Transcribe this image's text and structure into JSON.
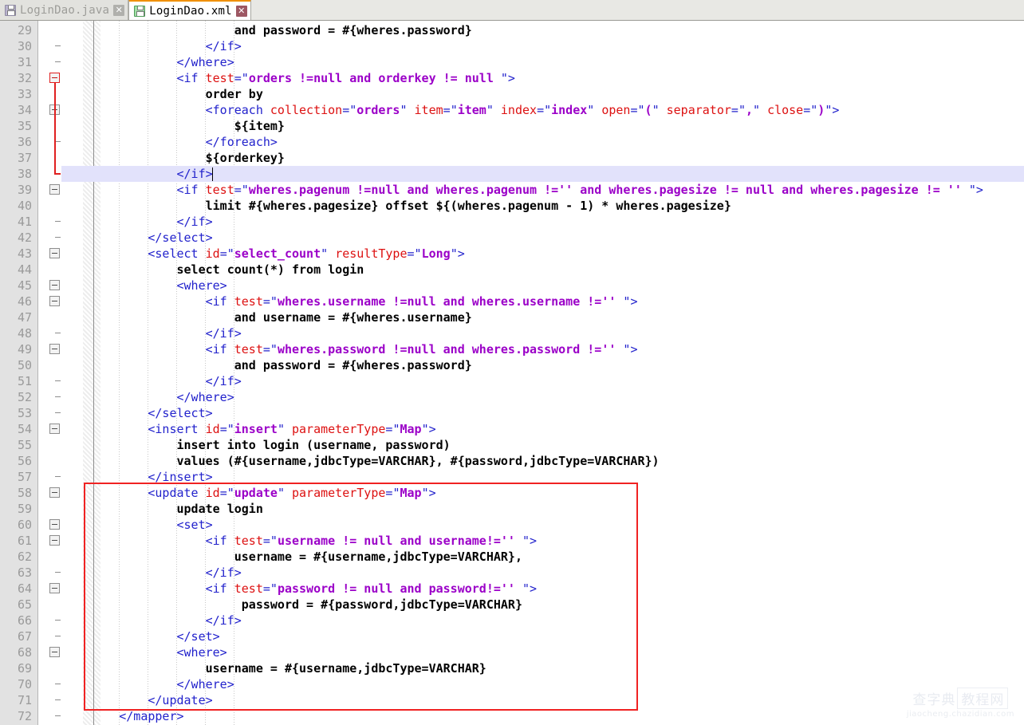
{
  "tabs": [
    {
      "label": "LoginDao.java",
      "icon": "file-java-icon",
      "close_label": "✕",
      "active": false
    },
    {
      "label": "LoginDao.xml",
      "icon": "file-xml-icon",
      "close_label": "✕",
      "active": true
    }
  ],
  "editor": {
    "active_file": "LoginDao.xml",
    "current_line": 38,
    "first_visible_line": 29,
    "last_visible_line": 72,
    "colors": {
      "tag": "#2222cc",
      "attribute_name": "#dd1111",
      "attribute_value": "#9b00c8",
      "text": "#000000",
      "gutter_background": "#e2e2e2",
      "line_number": "#9a9a9a",
      "current_line_highlight": "#e2e2fb",
      "annotation_box": "#f02222",
      "active_tab_accent": "#f09000"
    },
    "lines": [
      {
        "n": 29,
        "fold": "none",
        "tokens": [
          {
            "c": "txt",
            "s": "                        and password = #{wheres.password}"
          }
        ]
      },
      {
        "n": 30,
        "fold": "tick",
        "tokens": [
          {
            "c": "t",
            "s": "                    </if>"
          }
        ]
      },
      {
        "n": 31,
        "fold": "tick",
        "tokens": [
          {
            "c": "t",
            "s": "                </where>"
          }
        ]
      },
      {
        "n": 32,
        "fold": "box-red",
        "tokens": [
          {
            "c": "t",
            "s": "                <if "
          },
          {
            "c": "a",
            "s": "test"
          },
          {
            "c": "t",
            "s": "="
          },
          {
            "c": "q",
            "s": "\""
          },
          {
            "c": "v",
            "s": "orders !=null and orderkey != null "
          },
          {
            "c": "q",
            "s": "\""
          },
          {
            "c": "t",
            "s": ">"
          }
        ]
      },
      {
        "n": 33,
        "fold": "runred",
        "tokens": [
          {
            "c": "txt",
            "s": "                    order by"
          }
        ]
      },
      {
        "n": 34,
        "fold": "box-grey-red",
        "tokens": [
          {
            "c": "t",
            "s": "                    <foreach "
          },
          {
            "c": "a",
            "s": "collection"
          },
          {
            "c": "t",
            "s": "="
          },
          {
            "c": "q",
            "s": "\""
          },
          {
            "c": "v",
            "s": "orders"
          },
          {
            "c": "q",
            "s": "\""
          },
          {
            "c": "t",
            "s": " "
          },
          {
            "c": "a",
            "s": "item"
          },
          {
            "c": "t",
            "s": "="
          },
          {
            "c": "q",
            "s": "\""
          },
          {
            "c": "v",
            "s": "item"
          },
          {
            "c": "q",
            "s": "\""
          },
          {
            "c": "t",
            "s": " "
          },
          {
            "c": "a",
            "s": "index"
          },
          {
            "c": "t",
            "s": "="
          },
          {
            "c": "q",
            "s": "\""
          },
          {
            "c": "v",
            "s": "index"
          },
          {
            "c": "q",
            "s": "\""
          },
          {
            "c": "t",
            "s": " "
          },
          {
            "c": "a",
            "s": "open"
          },
          {
            "c": "t",
            "s": "="
          },
          {
            "c": "q",
            "s": "\""
          },
          {
            "c": "v",
            "s": "("
          },
          {
            "c": "q",
            "s": "\""
          },
          {
            "c": "t",
            "s": " "
          },
          {
            "c": "a",
            "s": "separator"
          },
          {
            "c": "t",
            "s": "="
          },
          {
            "c": "q",
            "s": "\""
          },
          {
            "c": "v",
            "s": ","
          },
          {
            "c": "q",
            "s": "\""
          },
          {
            "c": "t",
            "s": " "
          },
          {
            "c": "a",
            "s": "close"
          },
          {
            "c": "t",
            "s": "="
          },
          {
            "c": "q",
            "s": "\""
          },
          {
            "c": "v",
            "s": ")"
          },
          {
            "c": "q",
            "s": "\""
          },
          {
            "c": "t",
            "s": ">"
          }
        ]
      },
      {
        "n": 35,
        "fold": "runred",
        "tokens": [
          {
            "c": "txt",
            "s": "                        ${item}"
          }
        ]
      },
      {
        "n": 36,
        "fold": "tick-red",
        "tokens": [
          {
            "c": "t",
            "s": "                    </foreach>"
          }
        ]
      },
      {
        "n": 37,
        "fold": "runred",
        "tokens": [
          {
            "c": "txt",
            "s": "                    ${orderkey}"
          }
        ]
      },
      {
        "n": 38,
        "fold": "endred",
        "tokens": [
          {
            "c": "t",
            "s": "                </if>"
          }
        ]
      },
      {
        "n": 39,
        "fold": "box-grey",
        "tokens": [
          {
            "c": "t",
            "s": "                <if "
          },
          {
            "c": "a",
            "s": "test"
          },
          {
            "c": "t",
            "s": "="
          },
          {
            "c": "q",
            "s": "\""
          },
          {
            "c": "v",
            "s": "wheres.pagenum !=null and wheres.pagenum !='' and wheres.pagesize != null and wheres.pagesize != '' "
          },
          {
            "c": "q",
            "s": "\""
          },
          {
            "c": "t",
            "s": ">"
          }
        ]
      },
      {
        "n": 40,
        "fold": "none",
        "tokens": [
          {
            "c": "txt",
            "s": "                    limit #{wheres.pagesize} offset ${(wheres.pagenum - 1) * wheres.pagesize}"
          }
        ]
      },
      {
        "n": 41,
        "fold": "tick",
        "tokens": [
          {
            "c": "t",
            "s": "                </if>"
          }
        ]
      },
      {
        "n": 42,
        "fold": "tick",
        "tokens": [
          {
            "c": "t",
            "s": "            </select>"
          }
        ]
      },
      {
        "n": 43,
        "fold": "box-grey",
        "tokens": [
          {
            "c": "t",
            "s": "            <select "
          },
          {
            "c": "a",
            "s": "id"
          },
          {
            "c": "t",
            "s": "="
          },
          {
            "c": "q",
            "s": "\""
          },
          {
            "c": "v",
            "s": "select_count"
          },
          {
            "c": "q",
            "s": "\""
          },
          {
            "c": "t",
            "s": " "
          },
          {
            "c": "a",
            "s": "resultType"
          },
          {
            "c": "t",
            "s": "="
          },
          {
            "c": "q",
            "s": "\""
          },
          {
            "c": "v",
            "s": "Long"
          },
          {
            "c": "q",
            "s": "\""
          },
          {
            "c": "t",
            "s": ">"
          }
        ]
      },
      {
        "n": 44,
        "fold": "none",
        "tokens": [
          {
            "c": "txt",
            "s": "                select count(*) from login"
          }
        ]
      },
      {
        "n": 45,
        "fold": "box-grey",
        "tokens": [
          {
            "c": "t",
            "s": "                <where>"
          }
        ]
      },
      {
        "n": 46,
        "fold": "box-grey",
        "tokens": [
          {
            "c": "t",
            "s": "                    <if "
          },
          {
            "c": "a",
            "s": "test"
          },
          {
            "c": "t",
            "s": "="
          },
          {
            "c": "q",
            "s": "\""
          },
          {
            "c": "v",
            "s": "wheres.username !=null and wheres.username !='' "
          },
          {
            "c": "q",
            "s": "\""
          },
          {
            "c": "t",
            "s": ">"
          }
        ]
      },
      {
        "n": 47,
        "fold": "none",
        "tokens": [
          {
            "c": "txt",
            "s": "                        and username = #{wheres.username}"
          }
        ]
      },
      {
        "n": 48,
        "fold": "tick",
        "tokens": [
          {
            "c": "t",
            "s": "                    </if>"
          }
        ]
      },
      {
        "n": 49,
        "fold": "box-grey",
        "tokens": [
          {
            "c": "t",
            "s": "                    <if "
          },
          {
            "c": "a",
            "s": "test"
          },
          {
            "c": "t",
            "s": "="
          },
          {
            "c": "q",
            "s": "\""
          },
          {
            "c": "v",
            "s": "wheres.password !=null and wheres.password !='' "
          },
          {
            "c": "q",
            "s": "\""
          },
          {
            "c": "t",
            "s": ">"
          }
        ]
      },
      {
        "n": 50,
        "fold": "none",
        "tokens": [
          {
            "c": "txt",
            "s": "                        and password = #{wheres.password}"
          }
        ]
      },
      {
        "n": 51,
        "fold": "tick",
        "tokens": [
          {
            "c": "t",
            "s": "                    </if>"
          }
        ]
      },
      {
        "n": 52,
        "fold": "tick",
        "tokens": [
          {
            "c": "t",
            "s": "                </where>"
          }
        ]
      },
      {
        "n": 53,
        "fold": "tick",
        "tokens": [
          {
            "c": "t",
            "s": "            </select>"
          }
        ]
      },
      {
        "n": 54,
        "fold": "box-grey",
        "tokens": [
          {
            "c": "t",
            "s": "            <insert "
          },
          {
            "c": "a",
            "s": "id"
          },
          {
            "c": "t",
            "s": "="
          },
          {
            "c": "q",
            "s": "\""
          },
          {
            "c": "v",
            "s": "insert"
          },
          {
            "c": "q",
            "s": "\""
          },
          {
            "c": "t",
            "s": " "
          },
          {
            "c": "a",
            "s": "parameterType"
          },
          {
            "c": "t",
            "s": "="
          },
          {
            "c": "q",
            "s": "\""
          },
          {
            "c": "v",
            "s": "Map"
          },
          {
            "c": "q",
            "s": "\""
          },
          {
            "c": "t",
            "s": ">"
          }
        ]
      },
      {
        "n": 55,
        "fold": "none",
        "tokens": [
          {
            "c": "txt",
            "s": "                insert into login (username, password)"
          }
        ]
      },
      {
        "n": 56,
        "fold": "none",
        "tokens": [
          {
            "c": "txt",
            "s": "                values (#{username,jdbcType=VARCHAR}, #{password,jdbcType=VARCHAR})"
          }
        ]
      },
      {
        "n": 57,
        "fold": "tick",
        "tokens": [
          {
            "c": "t",
            "s": "            </insert>"
          }
        ]
      },
      {
        "n": 58,
        "fold": "box-grey",
        "tokens": [
          {
            "c": "t",
            "s": "            <update "
          },
          {
            "c": "a",
            "s": "id"
          },
          {
            "c": "t",
            "s": "="
          },
          {
            "c": "q",
            "s": "\""
          },
          {
            "c": "v",
            "s": "update"
          },
          {
            "c": "q",
            "s": "\""
          },
          {
            "c": "t",
            "s": " "
          },
          {
            "c": "a",
            "s": "parameterType"
          },
          {
            "c": "t",
            "s": "="
          },
          {
            "c": "q",
            "s": "\""
          },
          {
            "c": "v",
            "s": "Map"
          },
          {
            "c": "q",
            "s": "\""
          },
          {
            "c": "t",
            "s": ">"
          }
        ]
      },
      {
        "n": 59,
        "fold": "none",
        "tokens": [
          {
            "c": "txt",
            "s": "                update login"
          }
        ]
      },
      {
        "n": 60,
        "fold": "box-grey",
        "tokens": [
          {
            "c": "t",
            "s": "                <set>"
          }
        ]
      },
      {
        "n": 61,
        "fold": "box-grey",
        "tokens": [
          {
            "c": "t",
            "s": "                    <if "
          },
          {
            "c": "a",
            "s": "test"
          },
          {
            "c": "t",
            "s": "="
          },
          {
            "c": "q",
            "s": "\""
          },
          {
            "c": "v",
            "s": "username != null and username!='' "
          },
          {
            "c": "q",
            "s": "\""
          },
          {
            "c": "t",
            "s": ">"
          }
        ]
      },
      {
        "n": 62,
        "fold": "none",
        "tokens": [
          {
            "c": "txt",
            "s": "                        username = #{username,jdbcType=VARCHAR},"
          }
        ]
      },
      {
        "n": 63,
        "fold": "tick",
        "tokens": [
          {
            "c": "t",
            "s": "                    </if>"
          }
        ]
      },
      {
        "n": 64,
        "fold": "box-grey",
        "tokens": [
          {
            "c": "t",
            "s": "                    <if "
          },
          {
            "c": "a",
            "s": "test"
          },
          {
            "c": "t",
            "s": "="
          },
          {
            "c": "q",
            "s": "\""
          },
          {
            "c": "v",
            "s": "password != null and password!='' "
          },
          {
            "c": "q",
            "s": "\""
          },
          {
            "c": "t",
            "s": ">"
          }
        ]
      },
      {
        "n": 65,
        "fold": "none",
        "tokens": [
          {
            "c": "txt",
            "s": "                         password = #{password,jdbcType=VARCHAR}"
          }
        ]
      },
      {
        "n": 66,
        "fold": "tick",
        "tokens": [
          {
            "c": "t",
            "s": "                    </if>"
          }
        ]
      },
      {
        "n": 67,
        "fold": "tick",
        "tokens": [
          {
            "c": "t",
            "s": "                </set>"
          }
        ]
      },
      {
        "n": 68,
        "fold": "box-grey",
        "tokens": [
          {
            "c": "t",
            "s": "                <where>"
          }
        ]
      },
      {
        "n": 69,
        "fold": "none",
        "tokens": [
          {
            "c": "txt",
            "s": "                    username = #{username,jdbcType=VARCHAR}"
          }
        ]
      },
      {
        "n": 70,
        "fold": "tick",
        "tokens": [
          {
            "c": "t",
            "s": "                </where>"
          }
        ]
      },
      {
        "n": 71,
        "fold": "tick",
        "tokens": [
          {
            "c": "t",
            "s": "            </update>"
          }
        ]
      },
      {
        "n": 72,
        "fold": "tickend",
        "tokens": [
          {
            "c": "t",
            "s": "        </mapper>"
          }
        ]
      }
    ],
    "annotation": {
      "kind": "red-rectangle",
      "covers_lines": "58-71",
      "color": "#f02222"
    }
  },
  "watermark": {
    "line1_left": "查字典",
    "line1_right": "教程网",
    "line2": "jiaocheng.chazidian.com"
  }
}
